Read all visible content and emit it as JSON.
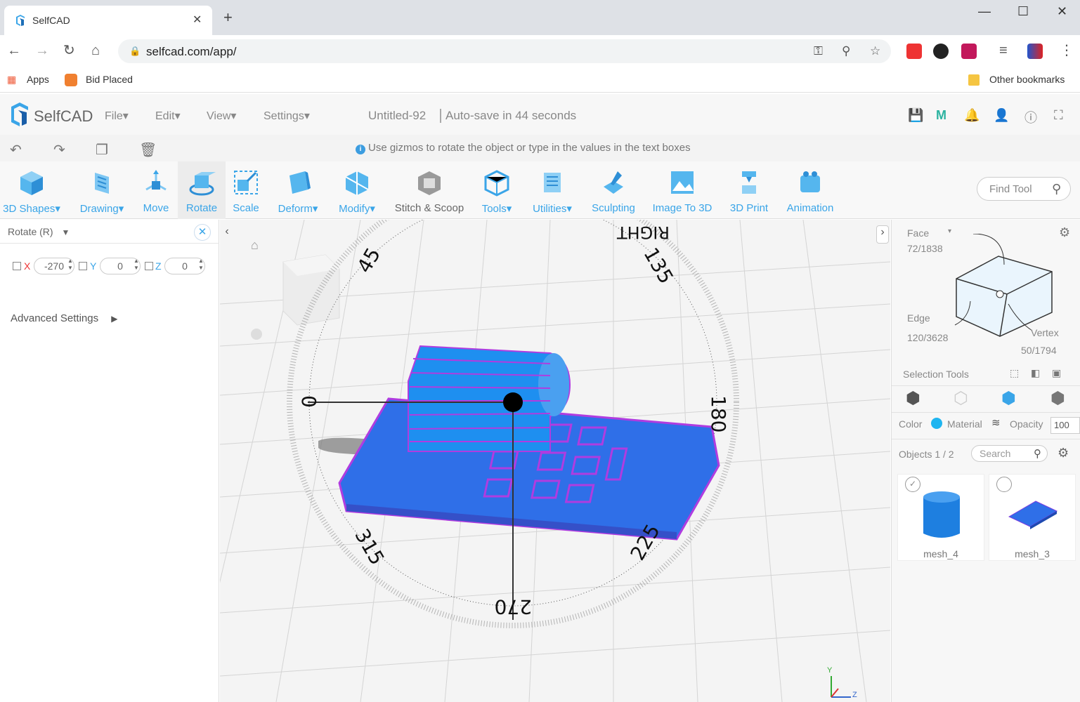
{
  "browser": {
    "tab_title": "SelfCAD",
    "url": "selfcad.com/app/",
    "bookmarks": [
      "Apps",
      "Bid Placed"
    ],
    "other_bookmarks": "Other bookmarks"
  },
  "app": {
    "logo_text": "SelfCAD",
    "menus": [
      "File▾",
      "Edit▾",
      "View▾",
      "Settings▾"
    ],
    "doc_title": "Untitled-92",
    "autosave": "Auto-save in 44 seconds",
    "hint": "Use gizmos to rotate the object or type in the values in the text boxes"
  },
  "toolbar": {
    "tools": [
      {
        "label": "3D Shapes▾",
        "icon": "cube-icon"
      },
      {
        "label": "Drawing▾",
        "icon": "drawing-icon"
      },
      {
        "label": "Move",
        "icon": "move-icon"
      },
      {
        "label": "Rotate",
        "icon": "rotate-icon"
      },
      {
        "label": "Scale",
        "icon": "scale-icon"
      },
      {
        "label": "Deform▾",
        "icon": "deform-icon"
      },
      {
        "label": "Modify▾",
        "icon": "modify-icon"
      },
      {
        "label": "Stitch & Scoop",
        "icon": "stitch-scoop-icon"
      },
      {
        "label": "Tools▾",
        "icon": "tools-icon"
      },
      {
        "label": "Utilities▾",
        "icon": "utilities-icon"
      },
      {
        "label": "Sculpting",
        "icon": "sculpting-icon"
      },
      {
        "label": "Image To 3D",
        "icon": "image-to-3d-icon"
      },
      {
        "label": "3D Print",
        "icon": "3d-print-icon"
      },
      {
        "label": "Animation",
        "icon": "animation-icon"
      }
    ],
    "find_tool": "Find Tool"
  },
  "left_panel": {
    "title": "Rotate (R)",
    "x_label": "X",
    "x_value": "-270",
    "y_label": "Y",
    "y_value": "0",
    "z_label": "Z",
    "z_value": "0",
    "advanced": "Advanced Settings"
  },
  "viewport": {
    "gizmo_labels": [
      "45",
      "135",
      "180",
      "225",
      "270",
      "315",
      "0"
    ],
    "view_cube_label": "RIGHT"
  },
  "right_panel": {
    "face_label": "Face",
    "face_count": "72/1838",
    "edge_label": "Edge",
    "edge_count": "120/3628",
    "vertex_label": "Vertex",
    "vertex_count": "50/1794",
    "selection_tools": "Selection Tools",
    "color_label": "Color",
    "material_label": "Material",
    "opacity_label": "Opacity",
    "opacity_value": "100",
    "objects_label": "Objects 1 / 2",
    "search_placeholder": "Search",
    "objects": [
      "mesh_4",
      "mesh_3"
    ]
  },
  "colors": {
    "accent": "#3aa5e8",
    "mesh": "#2f6fe8",
    "mesh_edges": "#b03ce0",
    "color_swatch": "#1fb5f0"
  }
}
